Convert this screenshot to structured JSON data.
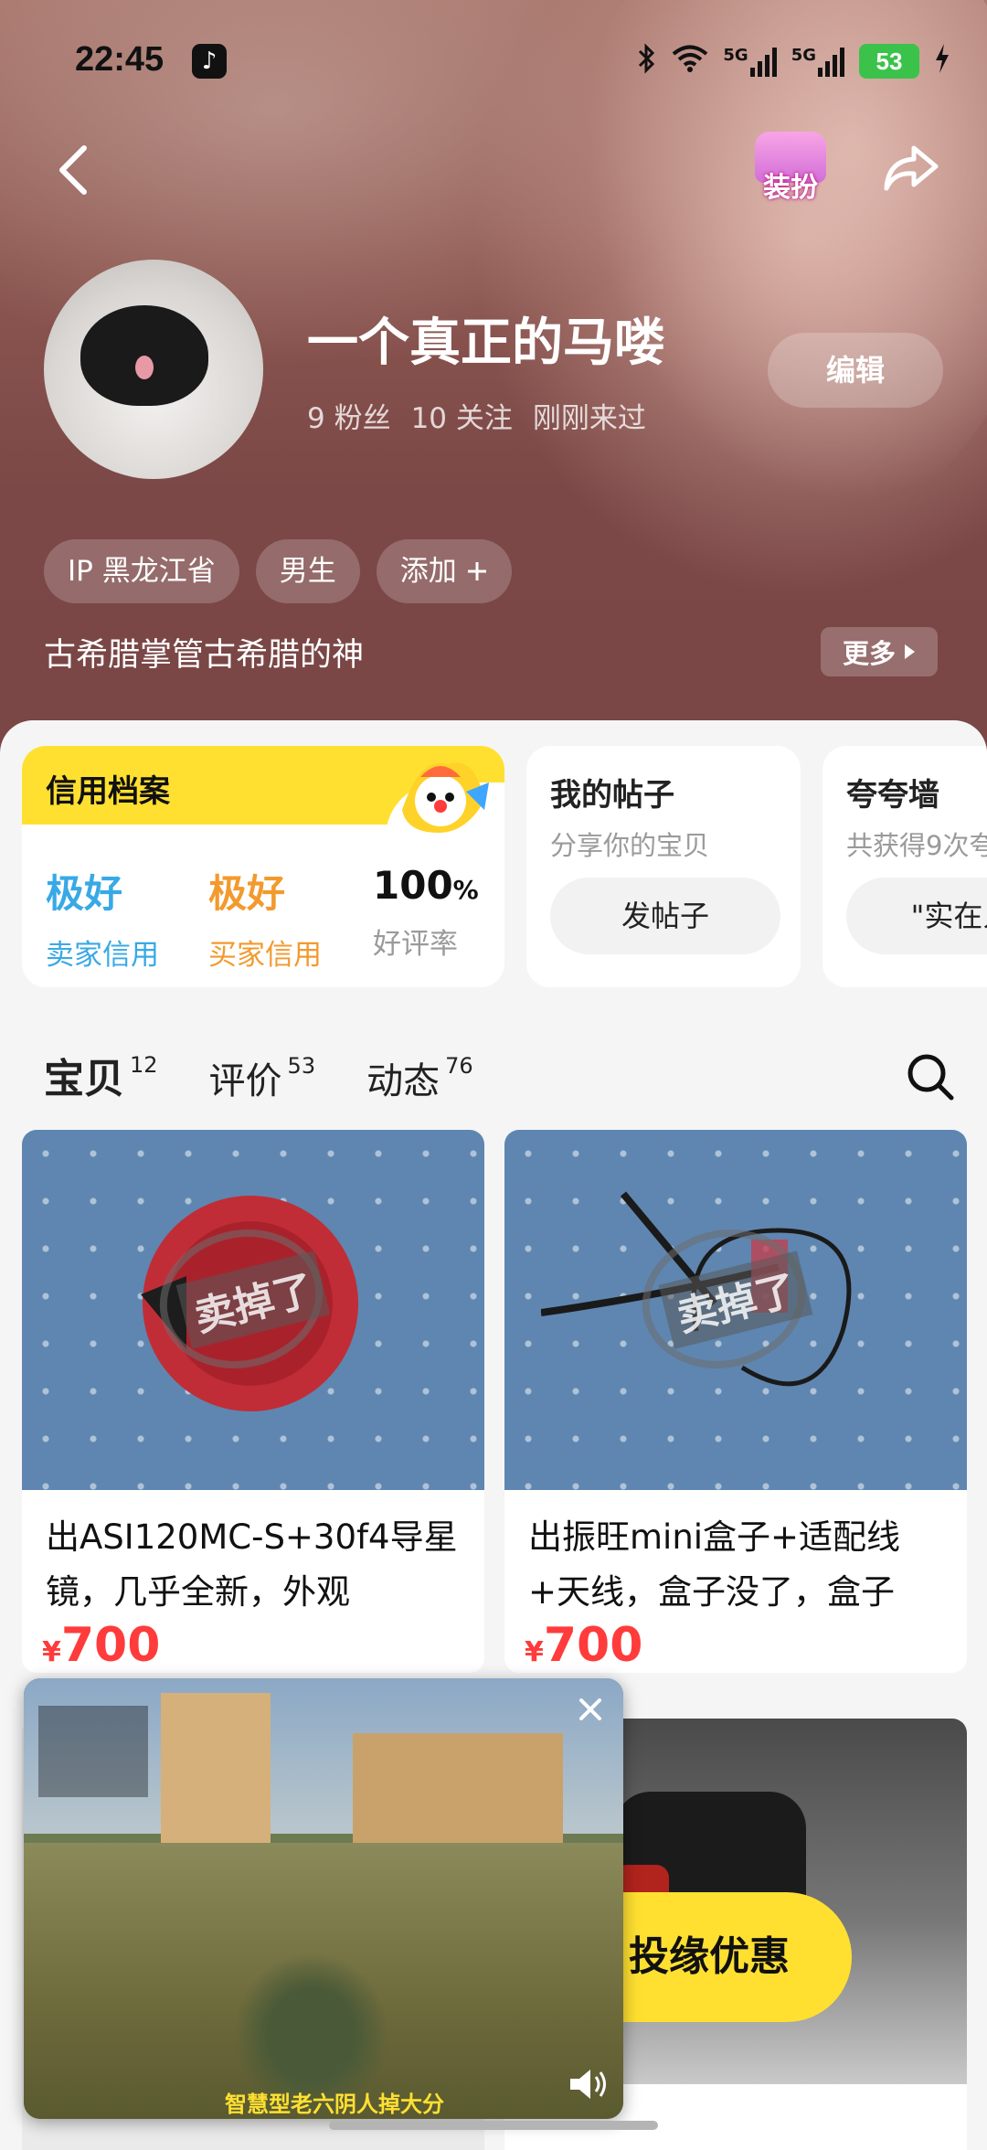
{
  "status_bar": {
    "time": "22:45",
    "net1": "5G",
    "net2": "5G",
    "battery": "53"
  },
  "header": {
    "dress_label": "装扮",
    "name": "一个真正的马喽",
    "fans": "9 粉丝",
    "follows": "10 关注",
    "last_seen": "刚刚来过",
    "edit_label": "编辑",
    "tags": [
      "IP 黑龙江省",
      "男生",
      "添加"
    ],
    "bio": "古希腊掌管古希腊的神",
    "more_label": "更多"
  },
  "credit": {
    "title": "信用档案",
    "seller_rating": "极好",
    "seller_label": "卖家信用",
    "buyer_rating": "极好",
    "buyer_label": "买家信用",
    "good_rate": "100",
    "good_rate_unit": "%",
    "good_rate_label": "好评率"
  },
  "posts": {
    "title": "我的帖子",
    "subtitle": "分享你的宝贝",
    "button": "发帖子"
  },
  "praise": {
    "title": "夸夸墙",
    "subtitle": "共获得9次夸",
    "button": "\"实在人"
  },
  "tabs": [
    {
      "label": "宝贝",
      "count": "12"
    },
    {
      "label": "评价",
      "count": "53"
    },
    {
      "label": "动态",
      "count": "76"
    }
  ],
  "products": [
    {
      "title": "出ASI120MC-S+30f4导星镜，几乎全新，外观",
      "currency": "¥",
      "price": "700",
      "sold": "卖掉了"
    },
    {
      "title": "出振旺mini盒子+适配线+天线，盒子没了，盒子",
      "currency": "¥",
      "price": "700",
      "sold": "卖掉了"
    }
  ],
  "promo": {
    "label": "投缘优惠"
  },
  "pip": {
    "banner": "智慧型老六阴人掉大分"
  },
  "colors": {
    "accent_yellow": "#ffe031",
    "seller_blue": "#38a9e6",
    "buyer_orange": "#f29a2e",
    "price_red": "#ff3b3b"
  }
}
